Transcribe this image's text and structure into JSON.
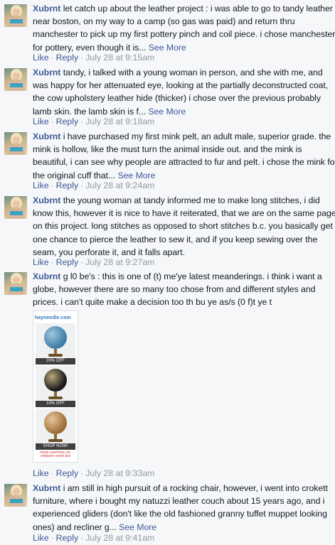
{
  "comments": [
    {
      "author": "Xubrnt",
      "lines": [
        " let catch up about the leather project : i was able to go to tandy leather",
        "near boston, on my way to a camp (so gas was paid) and return thru",
        "manchester to pick up my first pottery pinch and coil piece. i chose manchester",
        "for pottery, even though it is... "
      ],
      "see_more": "See More",
      "like": "Like",
      "reply": "Reply",
      "sep": "·",
      "time": "July 28 at 9:15am"
    },
    {
      "author": "Xubrnt",
      "lines": [
        " tandy, i talked with a young woman in person, and she with me, and",
        "was happy for her attenuated eye, looking at the partially deconstructed coat,",
        "the cow upholstery leather hide (thicker) i chose over the previous probably",
        "lamb skin. the lamb skin is f... "
      ],
      "see_more": "See More",
      "like": "Like",
      "reply": "Reply",
      "sep": "·",
      "time": "July 28 at 9:18am"
    },
    {
      "author": "Xubrnt",
      "lines": [
        " i have purchased my first mink pelt, an adult male, superior grade. the",
        "mink is hollow, like the must turn the animal inside out. and the mink is",
        "beautiful, i can see why people are attracted to fur and pelt. i chose the mink for",
        "the original cuff that... "
      ],
      "see_more": "See More",
      "like": "Like",
      "reply": "Reply",
      "sep": "·",
      "time": "July 28 at 9:24am"
    },
    {
      "author": "Xubrnt",
      "lines": [
        " the young woman at tandy informed me to make long stitches, i did",
        "know this, however it is nice to have it reiterated, that we are on the same page",
        "on this project. long stitches as opposed to short stitches b.c. you basically get",
        "one chance to pierce the leather to sew it, and if you keep sewing over the",
        "seam, you perforate it, and it falls apart."
      ],
      "see_more": "",
      "like": "Like",
      "reply": "Reply",
      "sep": "·",
      "time": "July 28 at 9:27am"
    },
    {
      "author": "Xubrnt",
      "lines": [
        " g l0 be's : this is one of (t) me'ye latest meanderings. i think i want a",
        "globe, however there are so many too chose from and different styles and",
        "prices. i can't quite make a decision too th bu ye as/s (0 f)t ye t"
      ],
      "see_more": "",
      "like": "Like",
      "reply": "Reply",
      "sep": "·",
      "time": "July 28 at 9:33am",
      "ad": {
        "logo": "hayneedle.com",
        "offers": [
          "20% OFF",
          "10% OFF",
          "SHOP NOW!"
        ],
        "footer": "FREE SHIPPING ON ORDERS OVER $49"
      }
    },
    {
      "author": "Xubrnt",
      "lines": [
        " i am still in high pursuit of a rocking chair, however, i went into crokett",
        "furniture, where i bought my natuzzi leather couch about 15 years ago, and i",
        "experienced gliders (don't like the old fashioned granny tuffet muppet looking",
        "ones) and recliner g... "
      ],
      "see_more": "See More",
      "like": "Like",
      "reply": "Reply",
      "sep": "·",
      "time": "July 28 at 9:41am"
    }
  ],
  "colors": {
    "background": "#f6f7f9",
    "link": "#3b5998",
    "text": "#141823",
    "meta": "#9197a3"
  }
}
